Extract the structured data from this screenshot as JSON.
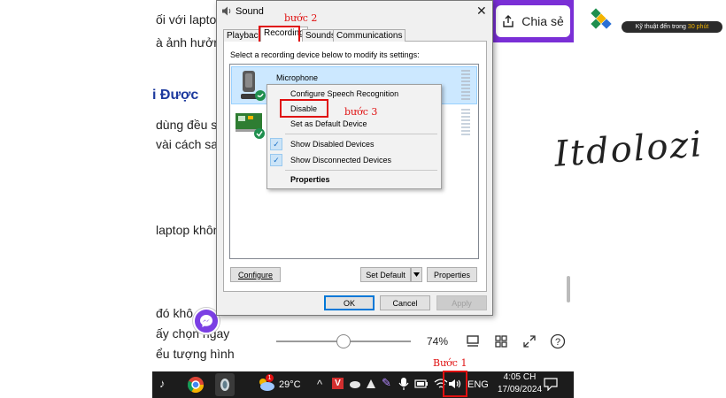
{
  "article": {
    "lines": [
      "ối với lapto",
      "à ảnh hưởr",
      "i Được",
      "dùng đều s",
      "vài cách sa",
      "laptop khôn",
      "đó khô",
      "ấy chọn ngay",
      "ểu tượng hình"
    ]
  },
  "share_button": {
    "label": "Chia sẻ"
  },
  "brand": {
    "tagline_prefix": "Kỹ thuật đến trong",
    "tagline_highlight": "30 phút",
    "signature": "Itdolozi"
  },
  "viewer": {
    "zoom_value": "74%"
  },
  "dialog": {
    "title": "Sound",
    "tabs": [
      "Playback",
      "Recording",
      "Sounds",
      "Communications"
    ],
    "active_tab": "Recording",
    "instruction": "Select a recording device below to modify its settings:",
    "devices": [
      {
        "name": "Microphone"
      }
    ],
    "buttons": {
      "configure": "Configure",
      "set_default": "Set Default",
      "properties": "Properties",
      "ok": "OK",
      "cancel": "Cancel",
      "apply": "Apply"
    }
  },
  "context_menu": {
    "items": [
      "Configure Speech Recognition",
      "Disable",
      "Set as Default Device",
      "Show Disabled Devices",
      "Show Disconnected Devices",
      "Properties"
    ]
  },
  "annotations": {
    "step1": "Bước 1",
    "step2": "bước 2",
    "step3": "bước 3"
  },
  "taskbar": {
    "weather": "29°C",
    "weather_badge": "1",
    "language": "ENG",
    "time": "4:05 CH",
    "date": "17/09/2024"
  },
  "colors": {
    "accent_purple": "#7a2fd6",
    "annotation_red": "#e01010",
    "selection_blue": "#cce8ff"
  }
}
